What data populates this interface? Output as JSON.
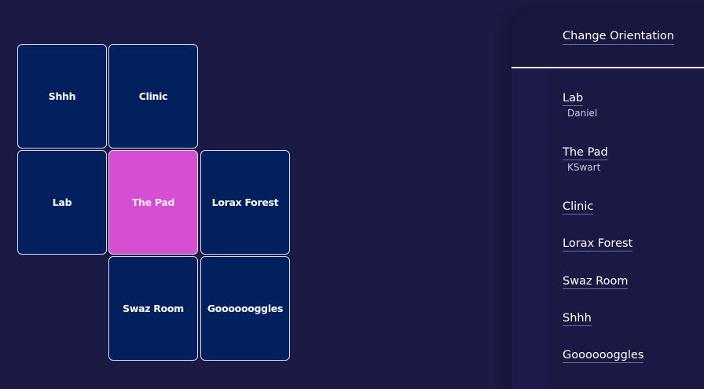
{
  "tiles": {
    "shhh": "Shhh",
    "clinic": "Clinic",
    "lab": "Lab",
    "the_pad": "The Pad",
    "lorax_forest": "Lorax Forest",
    "swaz_room": "Swaz Room",
    "gooooogles": "Gooooooggles",
    "active_tile": "The Pad"
  },
  "sidebar": {
    "change_orientation": "Change Orientation",
    "rooms": [
      {
        "name": "Lab",
        "user": "Daniel"
      },
      {
        "name": "The Pad",
        "user": "KSwart"
      },
      {
        "name": "Clinic"
      },
      {
        "name": "Lorax Forest"
      },
      {
        "name": "Swaz Room"
      },
      {
        "name": "Shhh"
      },
      {
        "name": "Gooooooggles"
      }
    ]
  },
  "colors": {
    "background": "#1b1a45",
    "tile": "#03205e",
    "active_tile": "#d64fd3",
    "tile_border": "#d9dbe8"
  }
}
